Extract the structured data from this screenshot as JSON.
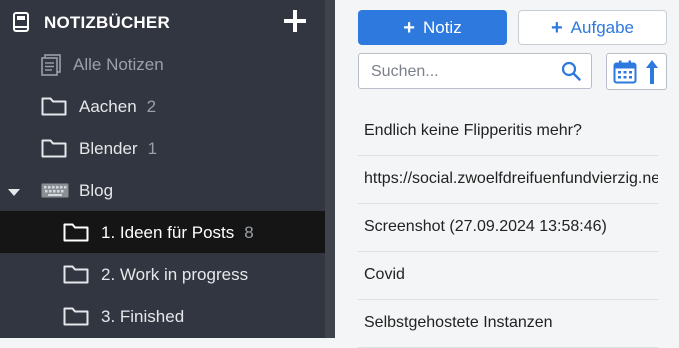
{
  "sidebar": {
    "title": "NOTIZBÜCHER",
    "items": [
      {
        "label": "Alle Notizen",
        "count": "",
        "icon": "all-notes-icon"
      },
      {
        "label": "Aachen",
        "count": "2",
        "icon": "folder-icon"
      },
      {
        "label": "Blender",
        "count": "1",
        "icon": "folder-icon"
      },
      {
        "label": "Blog",
        "count": "",
        "icon": "keyboard-icon"
      },
      {
        "label": "1. Ideen für Posts",
        "count": "8",
        "icon": "folder-icon"
      },
      {
        "label": "2. Work in progress",
        "count": "",
        "icon": "folder-icon"
      },
      {
        "label": "3. Finished",
        "count": "",
        "icon": "folder-icon"
      }
    ]
  },
  "toolbar": {
    "new_note_label": "Notiz",
    "new_task_label": "Aufgabe"
  },
  "search": {
    "placeholder": "Suchen...",
    "value": ""
  },
  "notes": [
    {
      "title": "Endlich keine Flipperitis mehr?"
    },
    {
      "title": "https://social.zwoelfdreifuenfundvierzig.net"
    },
    {
      "title": "Screenshot (27.09.2024 13:58:46)"
    },
    {
      "title": "Covid"
    },
    {
      "title": "Selbstgehostete Instanzen"
    }
  ],
  "colors": {
    "sidebar_bg": "#313640",
    "active_item_bg": "#151515",
    "accent": "#2e79de",
    "main_bg": "#f4f5f6"
  }
}
